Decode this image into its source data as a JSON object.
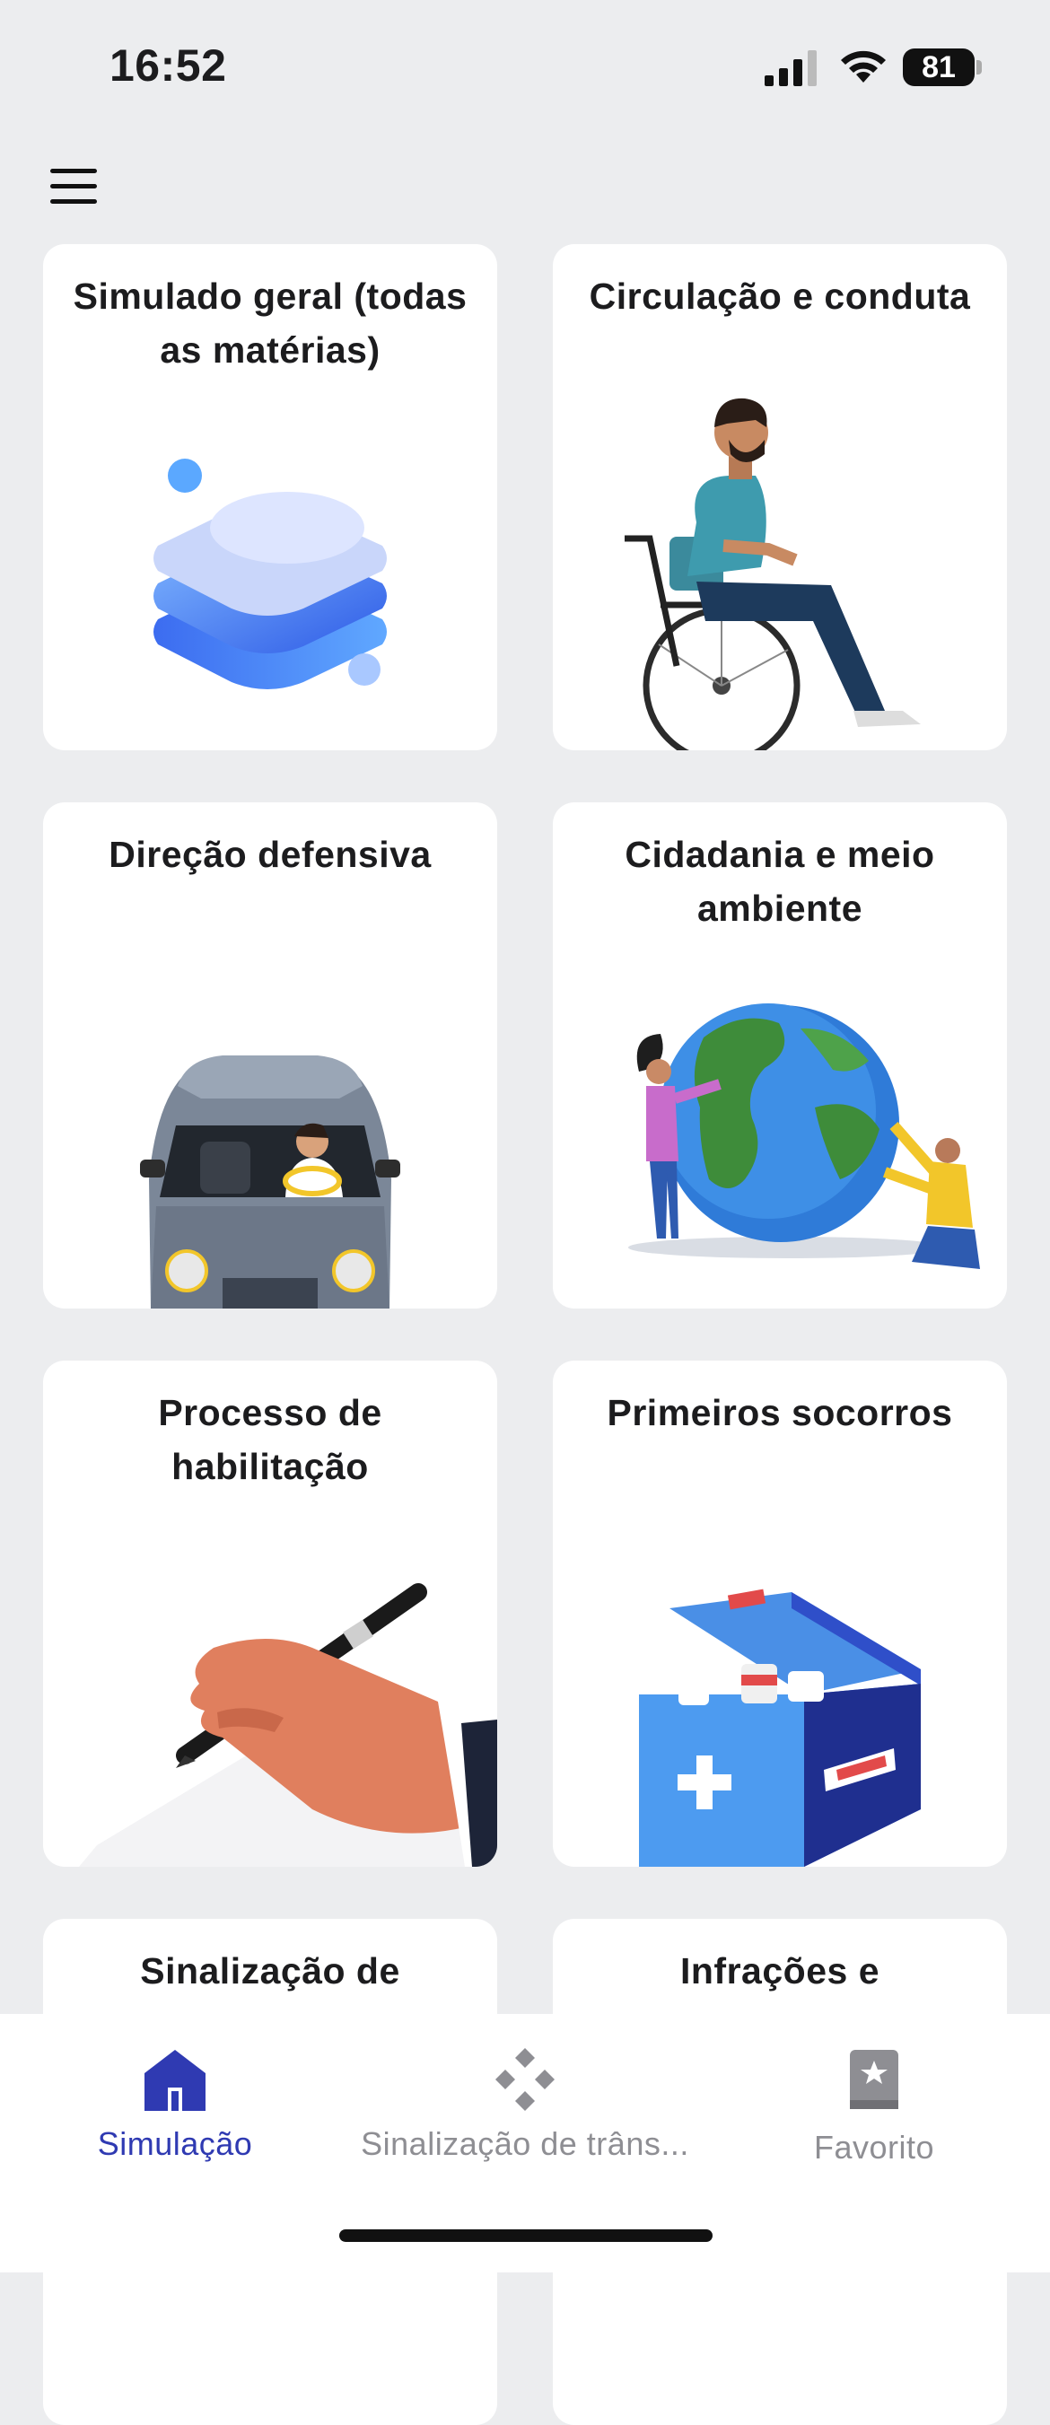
{
  "status_bar": {
    "time": "16:52",
    "battery": "81"
  },
  "cards": [
    {
      "title": "Simulado geral (todas as matérias)",
      "illustration": "stacked-layers-icon"
    },
    {
      "title": "Circulação e conduta",
      "illustration": "wheelchair-user-illustration"
    },
    {
      "title": "Direção defensiva",
      "illustration": "car-driver-illustration"
    },
    {
      "title": "Cidadania e meio ambiente",
      "illustration": "globe-people-illustration"
    },
    {
      "title": "Processo de habilitação",
      "illustration": "hand-pen-illustration"
    },
    {
      "title": "Primeiros socorros",
      "illustration": "first-aid-kit-illustration"
    },
    {
      "title": "Sinalização de",
      "illustration": ""
    },
    {
      "title": "Infrações e",
      "illustration": ""
    }
  ],
  "tabs": [
    {
      "label": "Simulação",
      "icon": "home-icon",
      "active": true
    },
    {
      "label": "Sinalização de trâns...",
      "icon": "diamond-signs-icon",
      "active": false
    },
    {
      "label": "Favorito",
      "icon": "bookmark-book-icon",
      "active": false
    }
  ],
  "colors": {
    "accent": "#2F3AB2",
    "inactive": "#8E8E93",
    "background": "#ECEDEF",
    "card": "#FFFFFF"
  }
}
